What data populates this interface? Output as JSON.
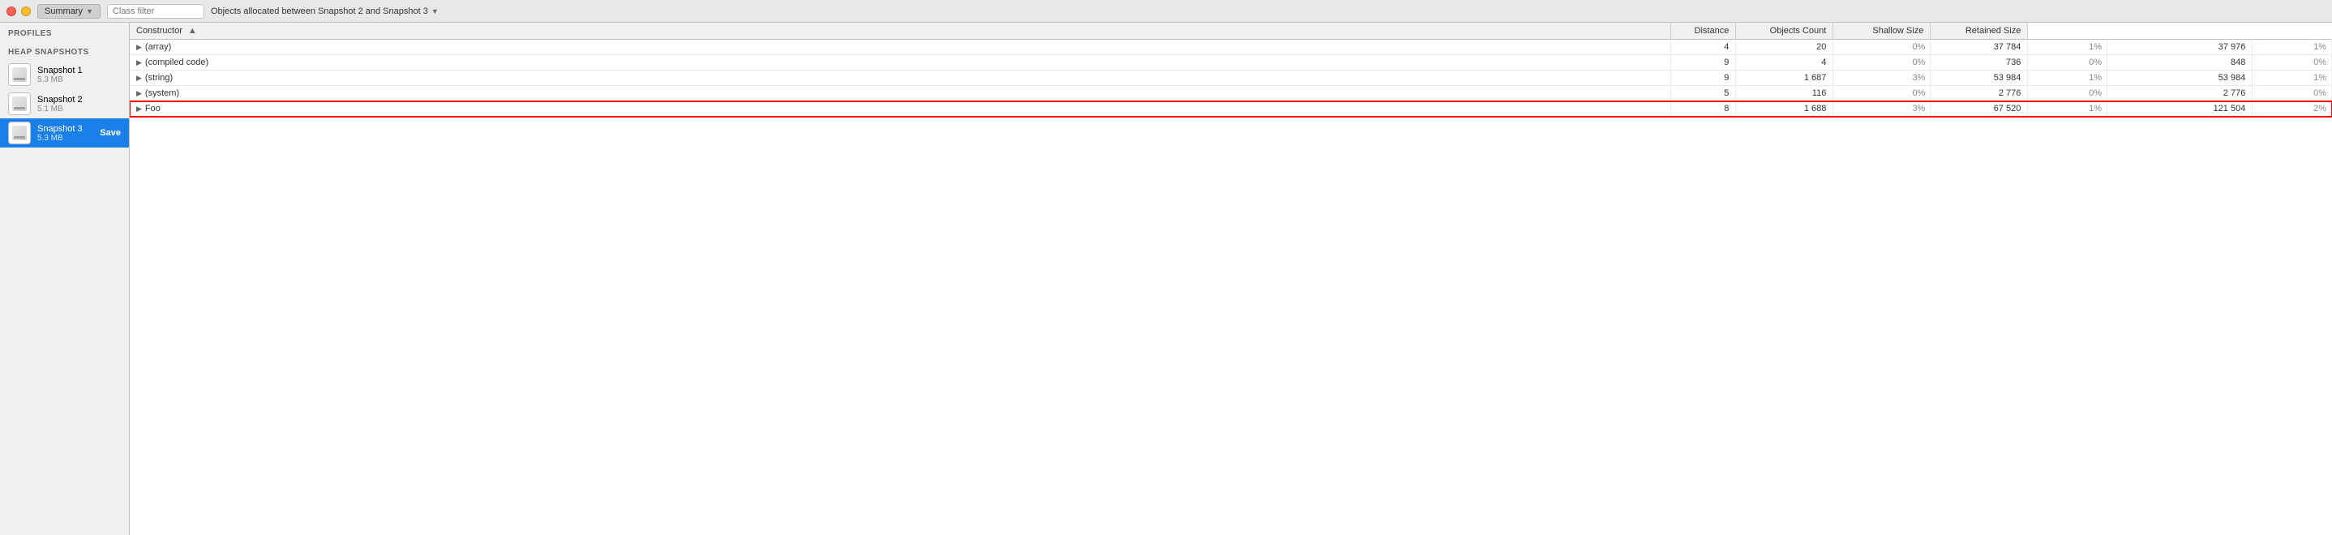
{
  "toolbar": {
    "summary_label": "Summary",
    "class_filter_placeholder": "Class filter",
    "allocation_label": "Objects allocated between Snapshot 2 and Snapshot 3",
    "dropdown_arrow": "▼"
  },
  "sidebar": {
    "section_label": "HEAP SNAPSHOTS",
    "profiles_label": "Profiles",
    "snapshots": [
      {
        "id": 1,
        "name": "Snapshot 1",
        "size": "5.3 MB",
        "active": false
      },
      {
        "id": 2,
        "name": "Snapshot 2",
        "size": "5.1 MB",
        "active": false
      },
      {
        "id": 3,
        "name": "Snapshot 3",
        "size": "5.3 MB",
        "active": true,
        "save": "Save"
      }
    ]
  },
  "table": {
    "headers": {
      "constructor": "Constructor",
      "distance": "Distance",
      "objects_count": "Objects Count",
      "shallow_size": "Shallow Size",
      "retained_size": "Retained Size"
    },
    "rows": [
      {
        "constructor": "(array)",
        "distance": "4",
        "objects_count": "20",
        "objects_pct": "0%",
        "shallow_val": "37 784",
        "shallow_pct": "1%",
        "retained_val": "37 976",
        "retained_pct": "1%",
        "highlight": false
      },
      {
        "constructor": "(compiled code)",
        "distance": "9",
        "objects_count": "4",
        "objects_pct": "0%",
        "shallow_val": "736",
        "shallow_pct": "0%",
        "retained_val": "848",
        "retained_pct": "0%",
        "highlight": false
      },
      {
        "constructor": "(string)",
        "distance": "9",
        "objects_count": "1 687",
        "objects_pct": "3%",
        "shallow_val": "53 984",
        "shallow_pct": "1%",
        "retained_val": "53 984",
        "retained_pct": "1%",
        "highlight": false
      },
      {
        "constructor": "(system)",
        "distance": "5",
        "objects_count": "116",
        "objects_pct": "0%",
        "shallow_val": "2 776",
        "shallow_pct": "0%",
        "retained_val": "2 776",
        "retained_pct": "0%",
        "highlight": false
      },
      {
        "constructor": "Foo",
        "distance": "8",
        "objects_count": "1 688",
        "objects_pct": "3%",
        "shallow_val": "67 520",
        "shallow_pct": "1%",
        "retained_val": "121 504",
        "retained_pct": "2%",
        "highlight": true
      }
    ]
  }
}
